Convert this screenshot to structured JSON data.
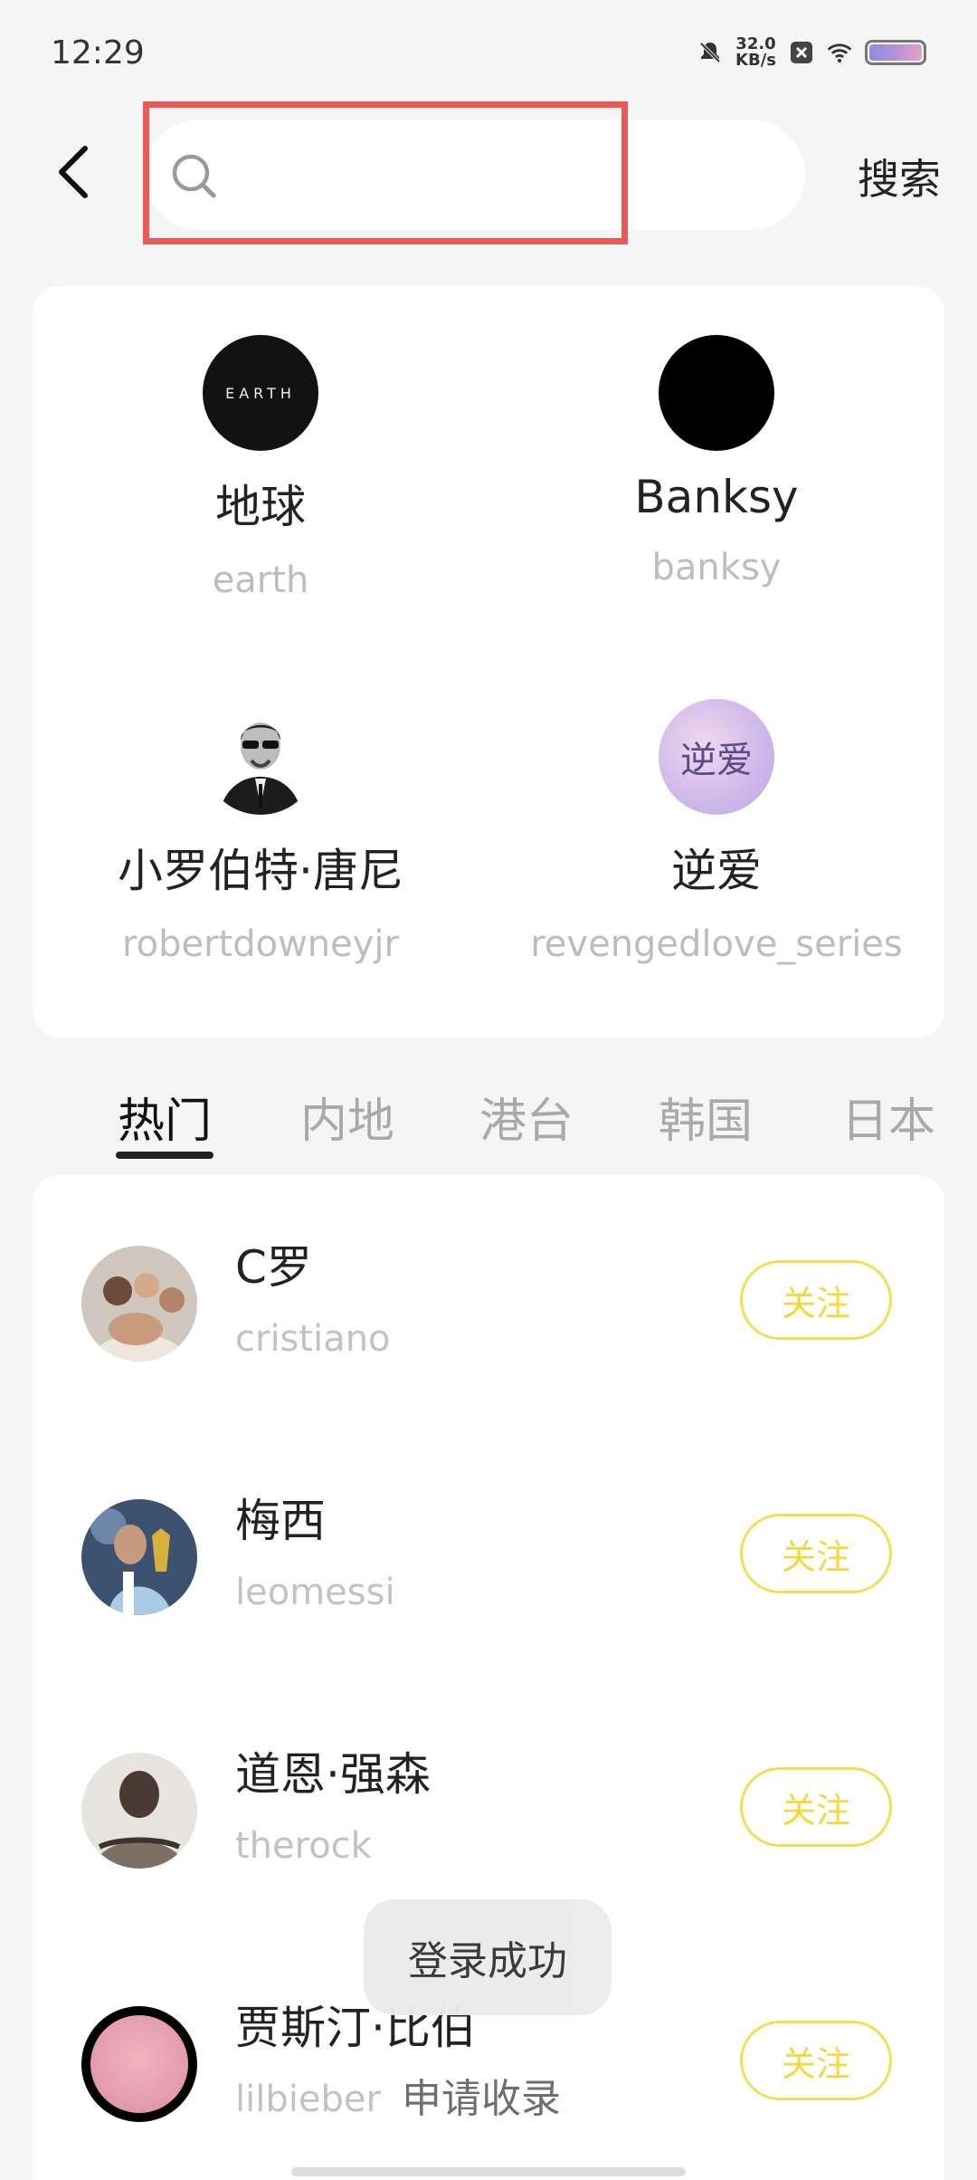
{
  "status_bar": {
    "time": "12:29",
    "speed_value": "32.0",
    "speed_unit": "KB/s",
    "icons": [
      "bell-muted-icon",
      "close-box-icon",
      "wifi-icon",
      "battery-icon"
    ]
  },
  "header": {
    "search_placeholder": "",
    "search_value": "",
    "search_button": "搜索"
  },
  "featured": [
    {
      "name": "地球",
      "handle": "earth",
      "avatar_text": "EARTH"
    },
    {
      "name": "Banksy",
      "handle": "banksy"
    },
    {
      "name": "小罗伯特·唐尼",
      "handle": "robertdowneyjr"
    },
    {
      "name": "逆爱",
      "handle": "revengedlove_series",
      "avatar_text": "逆爱"
    }
  ],
  "tabs": [
    {
      "label": "热门",
      "active": true
    },
    {
      "label": "内地",
      "active": false
    },
    {
      "label": "港台",
      "active": false
    },
    {
      "label": "韩国",
      "active": false
    },
    {
      "label": "日本",
      "active": false
    }
  ],
  "list": [
    {
      "name": "C罗",
      "handle": "cristiano",
      "button": "关注"
    },
    {
      "name": "梅西",
      "handle": "leomessi",
      "button": "关注"
    },
    {
      "name": "道恩·强森",
      "handle": "therock",
      "button": "关注"
    },
    {
      "name": "贾斯汀·比伯",
      "handle": "lilbieber",
      "button": "关注"
    }
  ],
  "toast": "登录成功",
  "apply_link": "申请收录",
  "colors": {
    "accent_yellow": "#f3d93d",
    "highlight_red": "#e85a55",
    "background": "#f5f5f5"
  }
}
